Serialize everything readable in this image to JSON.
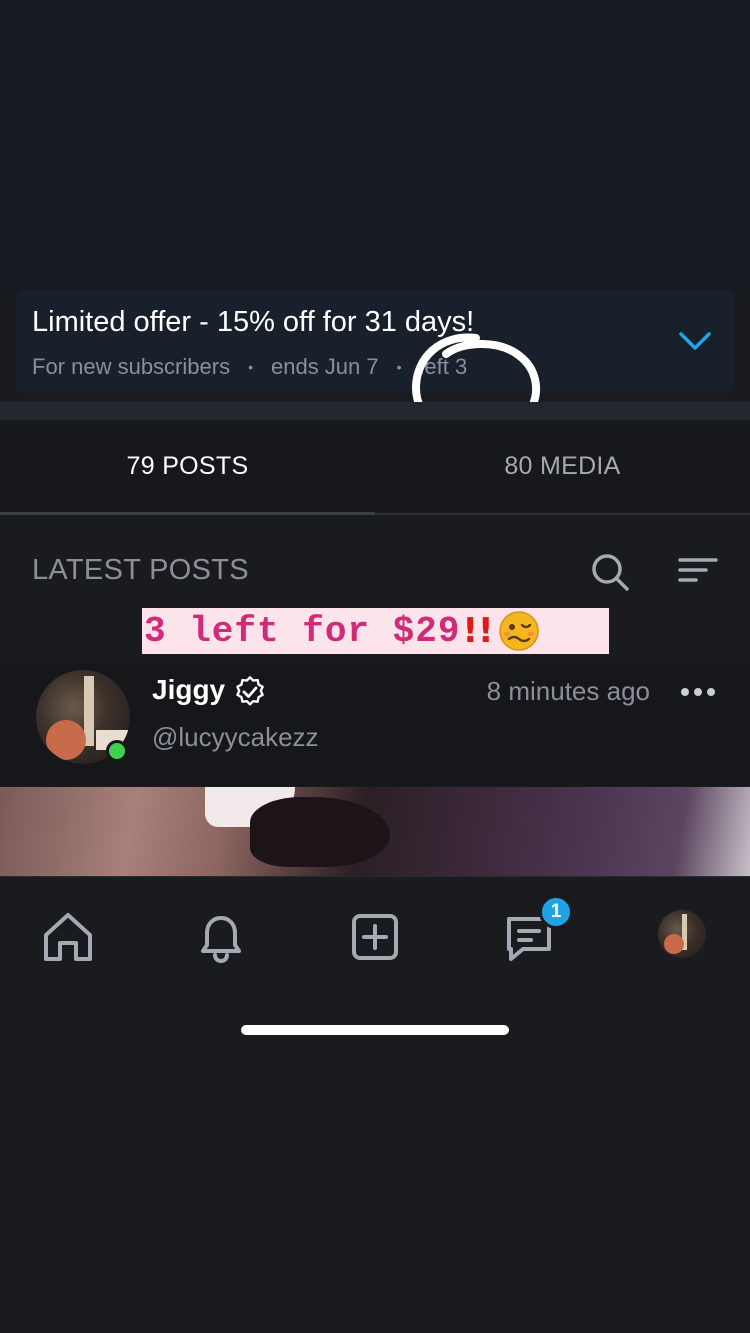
{
  "offer": {
    "title": "Limited offer - 15% off for 31 days!",
    "audience": "For new subscribers",
    "separator": "•",
    "ends": "ends Jun 7",
    "remaining": "left 3"
  },
  "tabs": [
    {
      "label": "79 POSTS",
      "active": true
    },
    {
      "label": "80 MEDIA",
      "active": false
    }
  ],
  "section": {
    "title": "LATEST POSTS"
  },
  "overlay": {
    "text": "3 left for $29",
    "emphasis": "!!"
  },
  "post": {
    "author_name": "Jiggy",
    "handle": "@lucyycakezz",
    "time": "8 minutes ago",
    "online": true
  },
  "nav": {
    "messages_badge": "1"
  },
  "colors": {
    "accent": "#1fa2e6",
    "online": "#3fd14d",
    "overlay_text": "#d02a78",
    "overlay_bg": "#fde3ea"
  },
  "icons": [
    "chevron-down-icon",
    "search-icon",
    "sort-icon",
    "verified-icon",
    "more-icon",
    "home-icon",
    "bell-icon",
    "plus-square-icon",
    "chat-icon"
  ]
}
